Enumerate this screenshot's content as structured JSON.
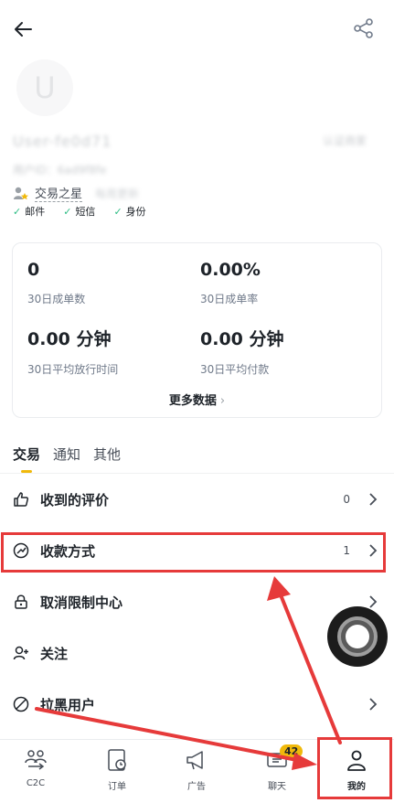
{
  "header": {
    "back_icon": "arrow-left-icon",
    "share_icon": "share-icon"
  },
  "profile": {
    "avatar_letter": "U",
    "nickname": "User-fe0d71",
    "user_id_label": "用户ID：6ad9f8fe",
    "badge_text": "认证商家",
    "star_label": "交易之星",
    "star_sub": "每周更新",
    "verifications": [
      "邮件",
      "短信",
      "身份"
    ]
  },
  "stats": {
    "items": [
      {
        "value": "0",
        "label": "30日成单数"
      },
      {
        "value": "0.00%",
        "label": "30日成单率"
      },
      {
        "value": "0.00 分钟",
        "label": "30日平均放行时间"
      },
      {
        "value": "0.00 分钟",
        "label": "30日平均付款"
      }
    ],
    "more_label": "更多数据"
  },
  "tabs": [
    "交易",
    "通知",
    "其他"
  ],
  "menu": [
    {
      "label": "收到的评价",
      "count": "0",
      "icon": "thumbs-up-icon"
    },
    {
      "label": "收款方式",
      "count": "1",
      "icon": "payment-method-icon"
    },
    {
      "label": "取消限制中心",
      "count": "",
      "icon": "lock-icon"
    },
    {
      "label": "关注",
      "count": "",
      "icon": "user-plus-icon"
    },
    {
      "label": "拉黑用户",
      "count": "",
      "icon": "block-icon"
    }
  ],
  "nav": [
    {
      "label": "C2C",
      "icon": "c2c-icon"
    },
    {
      "label": "订单",
      "icon": "order-icon"
    },
    {
      "label": "广告",
      "icon": "megaphone-icon"
    },
    {
      "label": "聊天",
      "icon": "chat-icon",
      "badge": "42"
    },
    {
      "label": "我的",
      "icon": "profile-icon",
      "active": true
    }
  ],
  "colors": {
    "accent": "#f0b90b",
    "annotation": "#e63a3a",
    "check": "#2ebd85"
  }
}
